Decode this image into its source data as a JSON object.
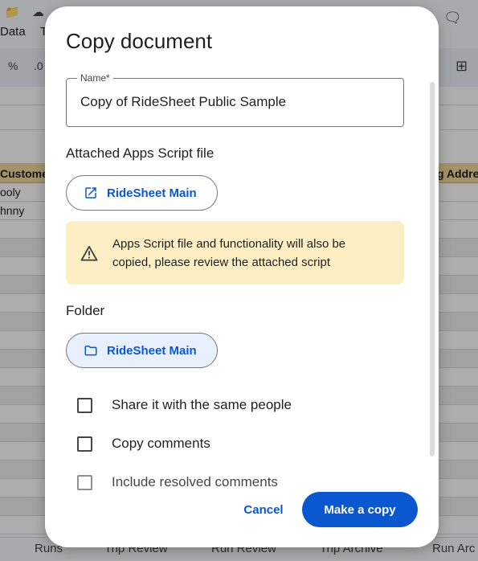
{
  "background": {
    "toolbar_menus": [
      "Data",
      "T"
    ],
    "format_items": [
      "%",
      ".0"
    ],
    "column_headers": [
      "Customer",
      "g Addre"
    ],
    "cells": [
      "ooly",
      "hnny"
    ],
    "sheet_tabs": [
      "Runs",
      "Trip Review",
      "Run Review",
      "Trip Archive",
      "Run Arc"
    ]
  },
  "dialog": {
    "title": "Copy document",
    "name_field": {
      "label": "Name*",
      "value": "Copy of RideSheet Public Sample"
    },
    "script_section": {
      "label": "Attached Apps Script file",
      "chip_label": "RideSheet Main",
      "chip_icon": "open-in-new-icon"
    },
    "warning": {
      "icon": "warning-icon",
      "text": "Apps Script file and functionality will also be copied, please review the attached script"
    },
    "folder_section": {
      "label": "Folder",
      "chip_label": "RideSheet Main",
      "chip_icon": "folder-icon"
    },
    "options": [
      {
        "label": "Share it with the same people",
        "checked": false,
        "disabled": false
      },
      {
        "label": "Copy comments",
        "checked": false,
        "disabled": false
      },
      {
        "label": "Include resolved comments",
        "checked": false,
        "disabled": true
      }
    ],
    "buttons": {
      "cancel": "Cancel",
      "confirm": "Make a copy"
    }
  },
  "colors": {
    "primary": "#0b57d0",
    "warning_bg": "#fdefc3",
    "selected_chip_bg": "#e8f0fe"
  }
}
